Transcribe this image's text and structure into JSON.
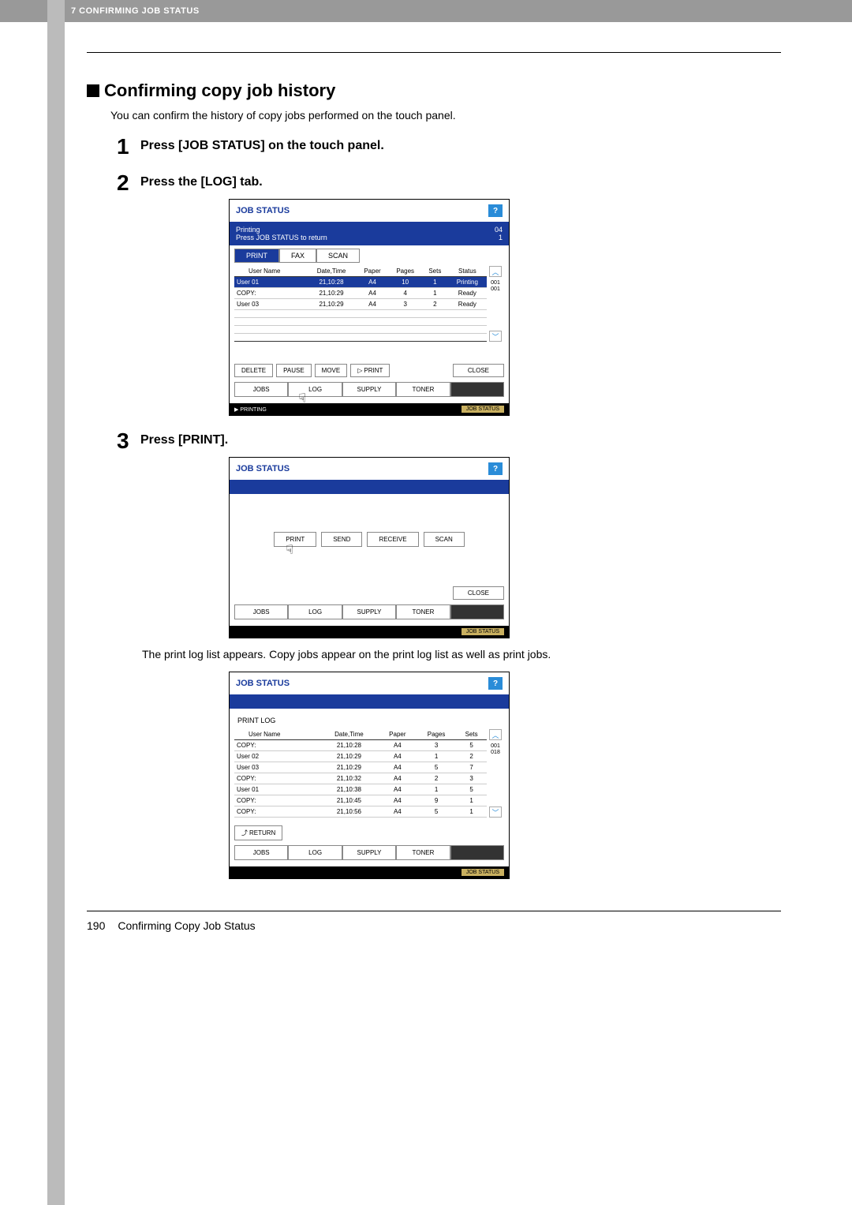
{
  "header": {
    "chapter": "7 CONFIRMING JOB STATUS"
  },
  "section": {
    "title": "Confirming copy job history",
    "intro": "You can confirm the history of copy jobs performed on the touch panel."
  },
  "steps": {
    "s1": {
      "num": "1",
      "text": "Press [JOB STATUS] on the touch panel."
    },
    "s2": {
      "num": "2",
      "text": "Press the [LOG] tab."
    },
    "s3": {
      "num": "3",
      "text": "Press [PRINT]."
    }
  },
  "caption_after_s3": "The print log list appears. Copy jobs appear on the print log list as well as print jobs.",
  "shot1": {
    "title": "JOB STATUS",
    "help": "?",
    "blue_left1": "Printing",
    "blue_left2": "Press JOB STATUS to return",
    "blue_right1": "04",
    "blue_right2": "1",
    "tabs": {
      "print": "PRINT",
      "fax": "FAX",
      "scan": "SCAN"
    },
    "cols": {
      "user": "User Name",
      "dt": "Date,Time",
      "paper": "Paper",
      "pages": "Pages",
      "sets": "Sets",
      "status": "Status"
    },
    "rows": [
      {
        "user": "User 01",
        "dt": "21,10:28",
        "paper": "A4",
        "pages": "10",
        "sets": "1",
        "status": "Printing",
        "sel": true
      },
      {
        "user": "COPY:",
        "dt": "21,10:29",
        "paper": "A4",
        "pages": "4",
        "sets": "1",
        "status": "Ready"
      },
      {
        "user": "User 03",
        "dt": "21,10:29",
        "paper": "A4",
        "pages": "3",
        "sets": "2",
        "status": "Ready"
      }
    ],
    "page_ind_top": "001",
    "page_ind_bot": "001",
    "actions": {
      "delete": "DELETE",
      "pause": "PAUSE",
      "move": "MOVE",
      "print": "PRINT",
      "close": "CLOSE"
    },
    "btabs": {
      "jobs": "JOBS",
      "log": "LOG",
      "supply": "SUPPLY",
      "toner": "TONER"
    },
    "footer_left": "PRINTING",
    "footer_right": "JOB STATUS"
  },
  "shot2": {
    "title": "JOB STATUS",
    "help": "?",
    "btns": {
      "print": "PRINT",
      "send": "SEND",
      "receive": "RECEIVE",
      "scan": "SCAN"
    },
    "close": "CLOSE",
    "btabs": {
      "jobs": "JOBS",
      "log": "LOG",
      "supply": "SUPPLY",
      "toner": "TONER"
    },
    "footer_right": "JOB STATUS"
  },
  "shot3": {
    "title": "JOB STATUS",
    "help": "?",
    "subtitle": "PRINT LOG",
    "cols": {
      "user": "User Name",
      "dt": "Date,Time",
      "paper": "Paper",
      "pages": "Pages",
      "sets": "Sets"
    },
    "rows": [
      {
        "user": "COPY:",
        "dt": "21,10:28",
        "paper": "A4",
        "pages": "3",
        "sets": "5"
      },
      {
        "user": "User 02",
        "dt": "21,10:29",
        "paper": "A4",
        "pages": "1",
        "sets": "2"
      },
      {
        "user": "User 03",
        "dt": "21,10:29",
        "paper": "A4",
        "pages": "5",
        "sets": "7"
      },
      {
        "user": "COPY:",
        "dt": "21,10:32",
        "paper": "A4",
        "pages": "2",
        "sets": "3"
      },
      {
        "user": "User 01",
        "dt": "21,10:38",
        "paper": "A4",
        "pages": "1",
        "sets": "5"
      },
      {
        "user": "COPY:",
        "dt": "21,10:45",
        "paper": "A4",
        "pages": "9",
        "sets": "1"
      },
      {
        "user": "COPY:",
        "dt": "21,10:56",
        "paper": "A4",
        "pages": "5",
        "sets": "1"
      }
    ],
    "page_ind_top": "001",
    "page_ind_bot": "018",
    "return": "RETURN",
    "btabs": {
      "jobs": "JOBS",
      "log": "LOG",
      "supply": "SUPPLY",
      "toner": "TONER"
    },
    "footer_right": "JOB STATUS"
  },
  "footer": {
    "page": "190",
    "title": "Confirming Copy Job Status"
  }
}
